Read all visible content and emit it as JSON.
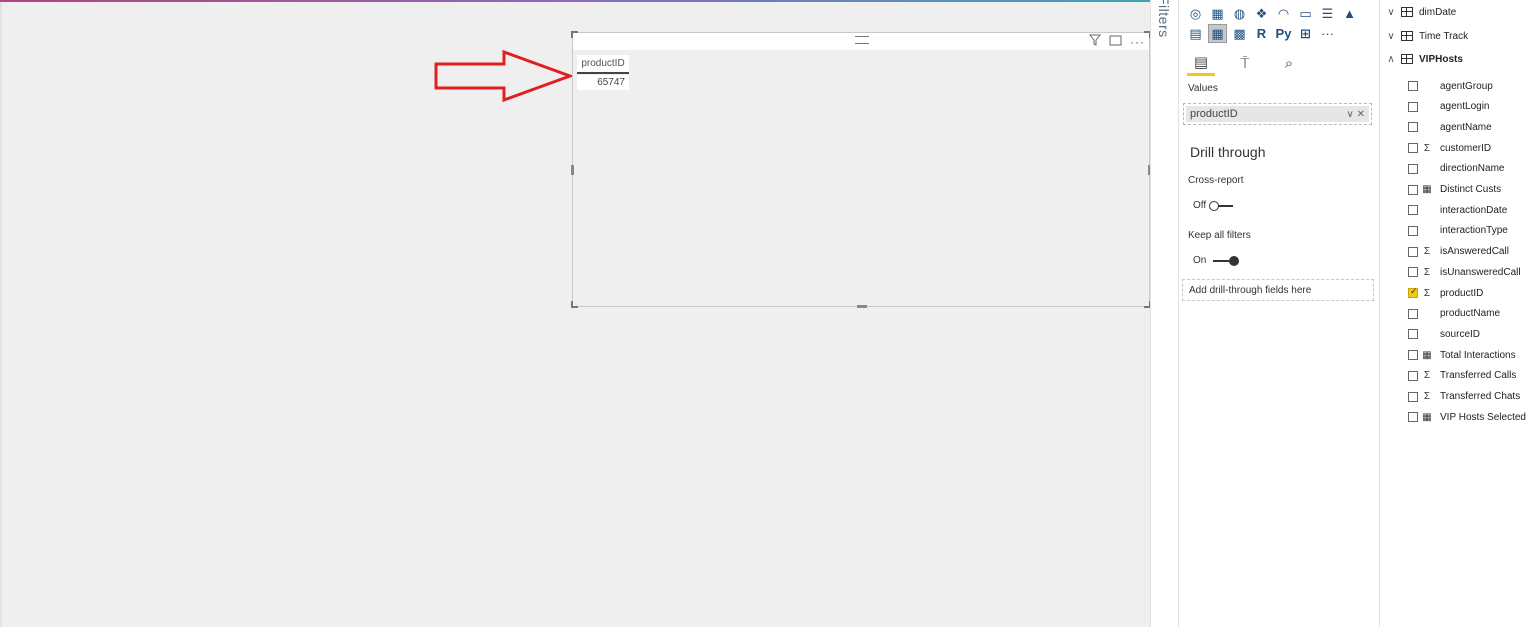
{
  "report": {
    "table_visual": {
      "column_header": "productID",
      "cell_value": "65747"
    }
  },
  "filters_pane": {
    "label": "Filters"
  },
  "visualizations_pane": {
    "values_label": "Values",
    "values_field": "productID",
    "drill_through_title": "Drill through",
    "cross_report_label": "Cross-report",
    "cross_report_state": "Off",
    "keep_filters_label": "Keep all filters",
    "keep_filters_state": "On",
    "drill_through_placeholder": "Add drill-through fields here",
    "icon_text": {
      "r": "R",
      "py": "Py",
      "more": "···"
    }
  },
  "fields_pane": {
    "tables": [
      {
        "name": "dimDate",
        "expanded": false
      },
      {
        "name": "Time Track",
        "expanded": false
      },
      {
        "name": "VIPHosts",
        "expanded": true
      }
    ],
    "fields": [
      {
        "name": "agentGroup",
        "type": "text",
        "checked": false
      },
      {
        "name": "agentLogin",
        "type": "text",
        "checked": false
      },
      {
        "name": "agentName",
        "type": "text",
        "checked": false
      },
      {
        "name": "customerID",
        "type": "sum",
        "checked": false
      },
      {
        "name": "directionName",
        "type": "text",
        "checked": false
      },
      {
        "name": "Distinct Custs",
        "type": "measure",
        "checked": false
      },
      {
        "name": "interactionDate",
        "type": "text",
        "checked": false
      },
      {
        "name": "interactionType",
        "type": "text",
        "checked": false
      },
      {
        "name": "isAnsweredCall",
        "type": "sum",
        "checked": false
      },
      {
        "name": "isUnansweredCall",
        "type": "sum",
        "checked": false
      },
      {
        "name": "productID",
        "type": "sum",
        "checked": true
      },
      {
        "name": "productName",
        "type": "text",
        "checked": false
      },
      {
        "name": "sourceID",
        "type": "text",
        "checked": false
      },
      {
        "name": "Total Interactions",
        "type": "measure",
        "checked": false
      },
      {
        "name": "Transferred Calls",
        "type": "sum",
        "checked": false
      },
      {
        "name": "Transferred Chats",
        "type": "sum",
        "checked": false
      },
      {
        "name": "VIP Hosts Selected",
        "type": "measure",
        "checked": false
      }
    ]
  },
  "colors": {
    "accent": "#f2c811",
    "arrow": "#e02020",
    "canvas": "#efefef"
  }
}
